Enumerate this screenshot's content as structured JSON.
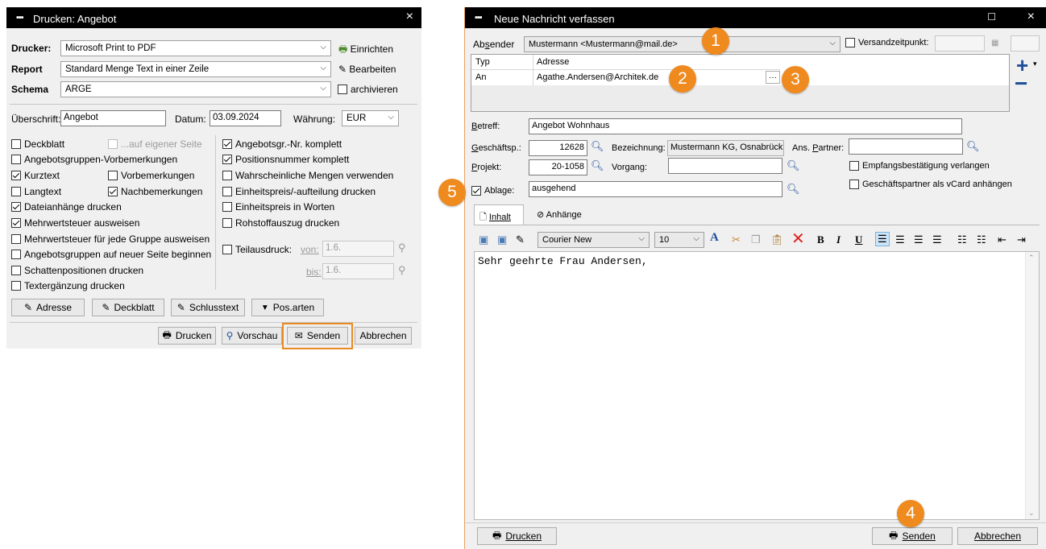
{
  "print_dialog": {
    "title": "Drucken: Angebot",
    "close_glyph": "×",
    "drucker_label": "Drucker:",
    "drucker_value": "Microsoft Print to PDF",
    "einrichten_label": "Einrichten",
    "report_label": "Report",
    "report_value": "Standard Menge Text in einer Zeile",
    "bearbeiten_label": "Bearbeiten",
    "schema_label": "Schema",
    "schema_value": "ARGE",
    "archivieren_label": "archivieren",
    "ueberschrift_label": "Überschrift:",
    "ueberschrift_value": "Angebot",
    "datum_label": "Datum:",
    "datum_value": "03.09.2024",
    "waehrung_label": "Währung:",
    "waehrung_value": "EUR",
    "options_left": [
      {
        "label": "Deckblatt",
        "checked": false
      },
      {
        "label": "Angebotsgruppen-Vorbemerkungen",
        "checked": false
      },
      {
        "label": "Kurztext",
        "checked": true
      },
      {
        "label": "Langtext",
        "checked": false
      },
      {
        "label": "Dateianhänge drucken",
        "checked": true
      },
      {
        "label": "Mehrwertsteuer ausweisen",
        "checked": true
      },
      {
        "label": "Mehrwertsteuer für jede Gruppe ausweisen",
        "checked": false
      },
      {
        "label": "Angebotsgruppen auf neuer Seite beginnen",
        "checked": false
      },
      {
        "label": "Schattenpositionen drucken",
        "checked": false
      },
      {
        "label": "Textergänzung drucken",
        "checked": false
      }
    ],
    "eigene_seite_label": "...auf eigener Seite",
    "vorbemerkungen_label": "Vorbemerkungen",
    "nachbemerkungen_label": "Nachbemerkungen",
    "options_right": [
      {
        "label": "Angebotsgr.-Nr. komplett",
        "checked": true
      },
      {
        "label": "Positionsnummer komplett",
        "checked": true
      },
      {
        "label": "Wahrscheinliche Mengen verwenden",
        "checked": false
      },
      {
        "label": "Einheitspreis/-aufteilung drucken",
        "checked": false
      },
      {
        "label": "Einheitspreis in Worten",
        "checked": false
      },
      {
        "label": "Rohstoffauszug drucken",
        "checked": false
      }
    ],
    "teilausdruck_label": "Teilausdruck:",
    "von_label": "von:",
    "von_value": "1.6.",
    "bis_label": "bis:",
    "bis_value": "1.6.",
    "buttons_row1": [
      "Adresse",
      "Deckblatt",
      "Schlusstext",
      "Pos.arten"
    ],
    "buttons_row2": [
      "Drucken",
      "Vorschau",
      "Senden",
      "Abbrechen"
    ]
  },
  "message_dialog": {
    "title": "Neue Nachricht verfassen",
    "minimize_glyph": "☐",
    "close_glyph": "×",
    "absender_label": "Absender",
    "absender_value": "Mustermann <Mustermann@mail.de>",
    "versandzeitpunkt_label": "Versandzeitpunkt:",
    "recipient_headers": [
      "Typ",
      "Adresse"
    ],
    "recipient_row": {
      "typ": "An",
      "adresse": "Agathe.Andersen@Architek.de"
    },
    "ellipsis_label": "···",
    "plus_label": "+",
    "minus_label": "−",
    "betreff_label": "Betreff:",
    "betreff_value": "Angebot Wohnhaus",
    "geschaeftsp_label": "Geschäftsp.:",
    "geschaeftsp_value": "12628",
    "bezeichnung_label": "Bezeichnung:",
    "bezeichnung_value": "Mustermann KG, Osnabrück",
    "ans_partner_label": "Ans. Partner:",
    "projekt_label": "Projekt:",
    "projekt_value": "20-1058",
    "vorgang_label": "Vorgang:",
    "empfangsbestaetigung_label": "Empfangsbestätigung verlangen",
    "vcard_label": "Geschäftspartner als vCard anhängen",
    "ablage_label": "Ablage:",
    "ablage_value": "ausgehend",
    "tab_inhalt": "Inhalt",
    "tab_anhaenge": "Anhänge",
    "font_name": "Courier New",
    "font_size": "10",
    "editor_text": "Sehr geehrte Frau Andersen,",
    "drucken_label": "Drucken",
    "senden_label": "Senden",
    "abbrechen_label": "Abbrechen"
  },
  "annotations": [
    "1",
    "2",
    "3",
    "4",
    "5"
  ],
  "colors": {
    "accent_orange": "#ef8a1f",
    "titlebar": "#000000",
    "icon_blue": "#1f4f9a"
  }
}
